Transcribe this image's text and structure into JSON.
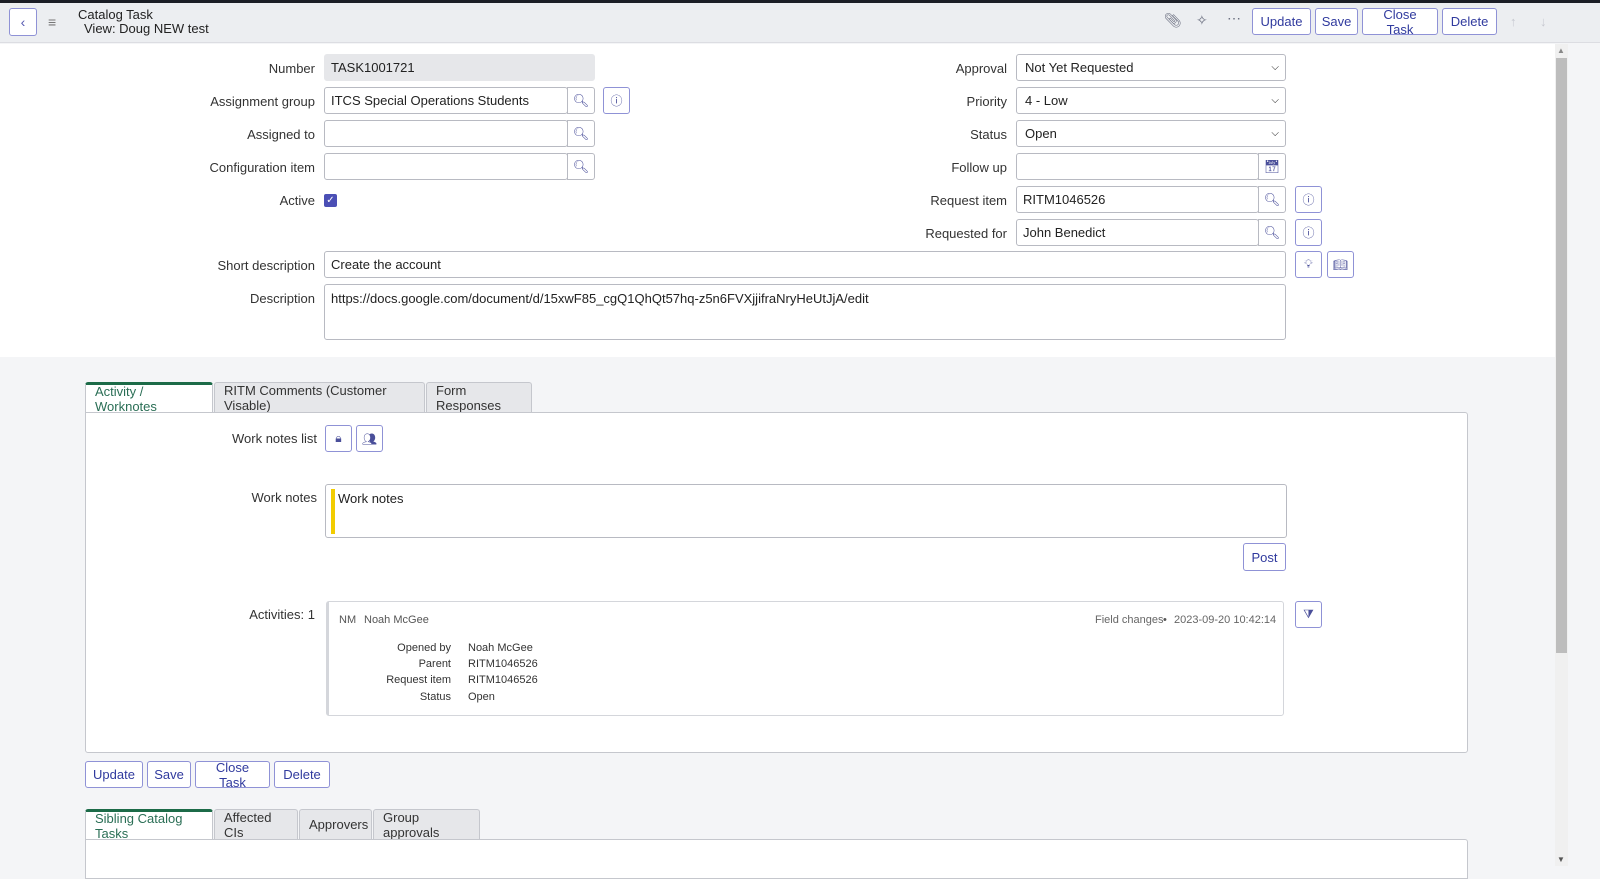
{
  "header": {
    "title": "Catalog Task",
    "view": "View: Doug NEW test",
    "icons": {
      "back": "chevron-left-icon",
      "menu": "hamburger-menu-icon",
      "attachment": "paperclip-icon",
      "activity": "pulse-icon",
      "more": "more-options-icon",
      "prev": "arrow-up-icon",
      "next": "arrow-down-icon"
    },
    "buttons": {
      "update": "Update",
      "save": "Save",
      "close_task": "Close Task",
      "delete": "Delete"
    }
  },
  "form": {
    "number": {
      "label": "Number",
      "value": "TASK1001721"
    },
    "assignment_group": {
      "label": "Assignment group",
      "value": "ITCS Special Operations Students"
    },
    "assigned_to": {
      "label": "Assigned to",
      "value": ""
    },
    "configuration_item": {
      "label": "Configuration item",
      "value": ""
    },
    "active": {
      "label": "Active",
      "checked": true
    },
    "approval": {
      "label": "Approval",
      "value": "Not Yet Requested"
    },
    "priority": {
      "label": "Priority",
      "value": "4 - Low"
    },
    "status": {
      "label": "Status",
      "value": "Open"
    },
    "follow_up": {
      "label": "Follow up",
      "value": ""
    },
    "request_item": {
      "label": "Request item",
      "value": "RITM1046526"
    },
    "requested_for": {
      "label": "Requested for",
      "value": "John Benedict"
    },
    "short_description": {
      "label": "Short description",
      "value": "Create the account"
    },
    "description": {
      "label": "Description",
      "value": "https://docs.google.com/document/d/15xwF85_cgQ1QhQt57hq-z5n6FVXjjifraNryHeUtJjA/edit"
    }
  },
  "tabs_primary": [
    {
      "label": "Activity / Worknotes",
      "active": true
    },
    {
      "label": "RITM Comments (Customer Visable)",
      "active": false
    },
    {
      "label": "Form Responses",
      "active": false
    }
  ],
  "activity_panel": {
    "work_notes_list_label": "Work notes list",
    "work_notes_label": "Work notes",
    "work_notes_placeholder": "Work notes",
    "post_label": "Post",
    "activities_label": "Activities: 1",
    "entry": {
      "initials": "NM",
      "author": "Noah McGee",
      "type": "Field changes",
      "separator": "•",
      "timestamp": "2023-09-20 10:42:14",
      "fields": [
        {
          "name": "Opened by",
          "value": "Noah McGee"
        },
        {
          "name": "Parent",
          "value": "RITM1046526"
        },
        {
          "name": "Request item",
          "value": "RITM1046526"
        },
        {
          "name": "Status",
          "value": "Open"
        }
      ]
    }
  },
  "bottom_buttons": {
    "update": "Update",
    "save": "Save",
    "close_task": "Close Task",
    "delete": "Delete"
  },
  "tabs_related": [
    {
      "label": "Sibling Catalog Tasks",
      "active": true
    },
    {
      "label": "Affected CIs",
      "active": false
    },
    {
      "label": "Approvers",
      "active": false
    },
    {
      "label": "Group approvals",
      "active": false
    }
  ]
}
